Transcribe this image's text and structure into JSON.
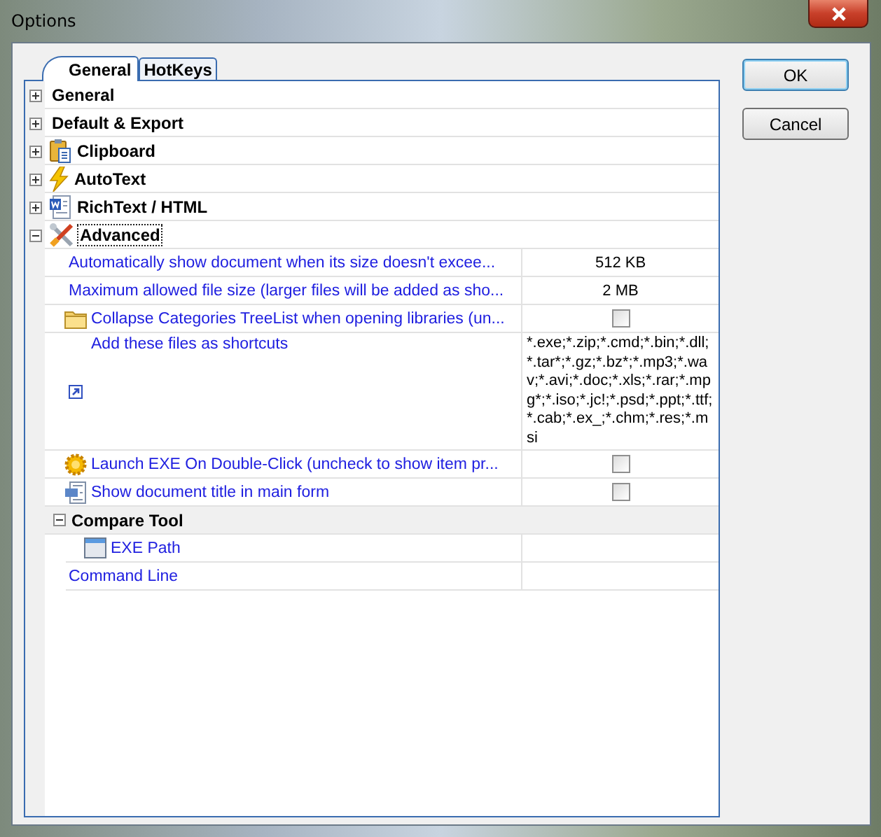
{
  "window": {
    "title": "Options"
  },
  "tabs": [
    {
      "label": "General",
      "selected": true
    },
    {
      "label": "HotKeys",
      "selected": false
    }
  ],
  "categories": [
    {
      "label": "General",
      "expanded": false,
      "selected": false
    },
    {
      "label": "Default & Export",
      "expanded": false,
      "selected": false
    },
    {
      "label": "Clipboard",
      "expanded": false,
      "selected": false
    },
    {
      "label": "AutoText",
      "expanded": false,
      "selected": false
    },
    {
      "label": "RichText / HTML",
      "expanded": false,
      "selected": false
    },
    {
      "label": "Advanced",
      "expanded": true,
      "selected": true,
      "children": [
        {
          "kind": "text",
          "label": "Automatically show document when its size doesn't excee...",
          "value": "512 KB"
        },
        {
          "kind": "text",
          "label": "Maximum allowed file size (larger files will be added as sho...",
          "value": "2 MB"
        },
        {
          "kind": "check",
          "label": "Collapse Categories TreeList when opening libraries (un...",
          "checked": false
        },
        {
          "kind": "list",
          "label": "Add these files as shortcuts",
          "value": "*.exe;*.zip;*.cmd;*.bin;*.dll;*.tar*;*.gz;*.bz*;*.mp3;*.wav;*.avi;*.doc;*.xls;*.rar;*.mpg*;*.iso;*.jc!;*.psd;*.ppt;*.ttf;*.cab;*.ex_;*.chm;*.res;*.msi"
        },
        {
          "kind": "check",
          "label": "Launch EXE On Double-Click (uncheck to show item pr...",
          "checked": false
        },
        {
          "kind": "check",
          "label": "Show document title in main form",
          "checked": false
        },
        {
          "kind": "group",
          "label": "Compare Tool",
          "expanded": true,
          "children": [
            {
              "kind": "text",
              "label": "EXE Path"
            },
            {
              "kind": "text",
              "label": "Command Line"
            }
          ]
        }
      ]
    }
  ],
  "buttons": [
    {
      "label": "OK",
      "default": true
    },
    {
      "label": "Cancel",
      "default": false
    }
  ]
}
